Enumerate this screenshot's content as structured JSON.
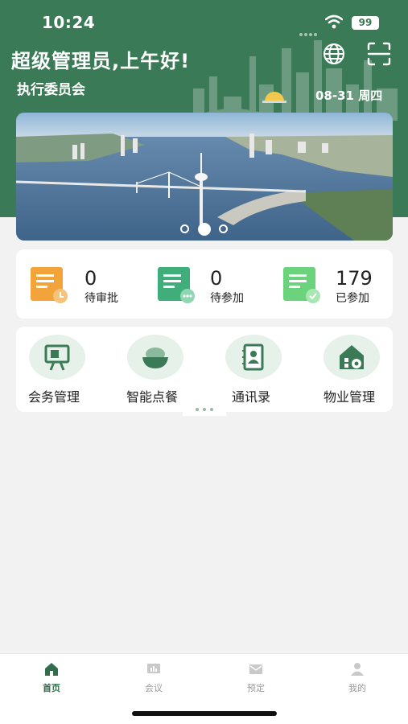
{
  "status_bar": {
    "time": "10:24",
    "battery": "99"
  },
  "header": {
    "greeting": "超级管理员,上午好!",
    "org": "执行委员会",
    "date": "08-31 周四",
    "icons": [
      "globe-icon",
      "scan-icon"
    ]
  },
  "banner": {
    "active_index": 1,
    "total": 3
  },
  "stats": [
    {
      "value": "0",
      "label": "待审批",
      "icon": "pending-approval-icon",
      "color": "#f2a33a"
    },
    {
      "value": "0",
      "label": "待参加",
      "icon": "to-attend-icon",
      "color": "#3fae7a"
    },
    {
      "value": "179",
      "label": "已参加",
      "icon": "attended-icon",
      "color": "#6ad37c"
    }
  ],
  "shortcuts": [
    {
      "label": "会务管理",
      "icon": "meeting-board-icon"
    },
    {
      "label": "智能点餐",
      "icon": "food-bowl-icon"
    },
    {
      "label": "通讯录",
      "icon": "contacts-book-icon"
    },
    {
      "label": "物业管理",
      "icon": "property-house-icon"
    }
  ],
  "tabbar": [
    {
      "label": "首页",
      "active": true
    },
    {
      "label": "会议",
      "active": false
    },
    {
      "label": "预定",
      "active": false
    },
    {
      "label": "我的",
      "active": false
    }
  ],
  "colors": {
    "brand": "#3b7a57",
    "icon_bg": "#e6f1ea",
    "active_tab": "#2f6f4c"
  }
}
